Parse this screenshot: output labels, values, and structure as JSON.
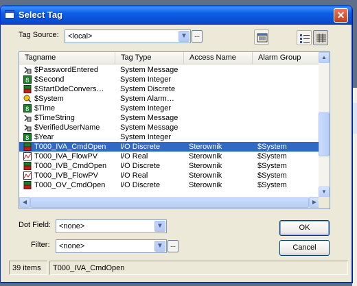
{
  "background": {
    "left_tab_letters": "s",
    "left_heading_letters": "ie",
    "right_text_1": "il",
    "right_text_2": "l",
    "right_text_3": "il"
  },
  "dialog": {
    "title": "Select Tag",
    "close_glyph": "✕"
  },
  "tag_source": {
    "label": "Tag Source:",
    "value": "<local>",
    "browse_label": "..."
  },
  "toolbar": {
    "tree_view_icon": "tree-icon",
    "details_view_icon": "details-icon",
    "table_view_icon": "table-icon"
  },
  "tag_list": {
    "columns": [
      "Tagname",
      "Tag Type",
      "Access Name",
      "Alarm Group"
    ],
    "rows": [
      {
        "icon": "message",
        "tagname": "$PasswordEntered",
        "type": "System Message",
        "access": "",
        "alarm": "",
        "selected": false
      },
      {
        "icon": "integer",
        "tagname": "$Second",
        "type": "System Integer",
        "access": "",
        "alarm": "",
        "selected": false
      },
      {
        "icon": "discrete",
        "tagname": "$StartDdeConvers…",
        "type": "System Discrete",
        "access": "",
        "alarm": "",
        "selected": false
      },
      {
        "icon": "alarm",
        "tagname": "$System",
        "type": "System Alarm…",
        "access": "",
        "alarm": "",
        "selected": false
      },
      {
        "icon": "integer",
        "tagname": "$Time",
        "type": "System Integer",
        "access": "",
        "alarm": "",
        "selected": false
      },
      {
        "icon": "message",
        "tagname": "$TimeString",
        "type": "System Message",
        "access": "",
        "alarm": "",
        "selected": false
      },
      {
        "icon": "message",
        "tagname": "$VerifiedUserName",
        "type": "System Message",
        "access": "",
        "alarm": "",
        "selected": false
      },
      {
        "icon": "integer",
        "tagname": "$Year",
        "type": "System Integer",
        "access": "",
        "alarm": "",
        "selected": false
      },
      {
        "icon": "discrete",
        "tagname": "T000_IVA_CmdOpen",
        "type": "I/O Discrete",
        "access": "Sterownik",
        "alarm": "$System",
        "selected": true
      },
      {
        "icon": "real",
        "tagname": "T000_IVA_FlowPV",
        "type": "I/O Real",
        "access": "Sterownik",
        "alarm": "$System",
        "selected": false
      },
      {
        "icon": "discrete",
        "tagname": "T000_IVB_CmdOpen",
        "type": "I/O Discrete",
        "access": "Sterownik",
        "alarm": "$System",
        "selected": false
      },
      {
        "icon": "real",
        "tagname": "T000_IVB_FlowPV",
        "type": "I/O Real",
        "access": "Sterownik",
        "alarm": "$System",
        "selected": false
      },
      {
        "icon": "discrete",
        "tagname": "T000_OV_CmdOpen",
        "type": "I/O Discrete",
        "access": "Sterownik",
        "alarm": "$System",
        "selected": false
      }
    ],
    "vertical_scroll_position": 0.62
  },
  "dot_field": {
    "label": "Dot Field:",
    "value": "<none>"
  },
  "filter": {
    "label": "Filter:",
    "value": "<none>",
    "browse_label": "..."
  },
  "buttons": {
    "ok": "OK",
    "cancel": "Cancel"
  },
  "status": {
    "count": "39 items",
    "selected_tag": "T000_IVA_CmdOpen"
  },
  "colors": {
    "title_blue": "#0a5ce8",
    "selection": "#316ac5",
    "dialog_face": "#ece9d8"
  }
}
